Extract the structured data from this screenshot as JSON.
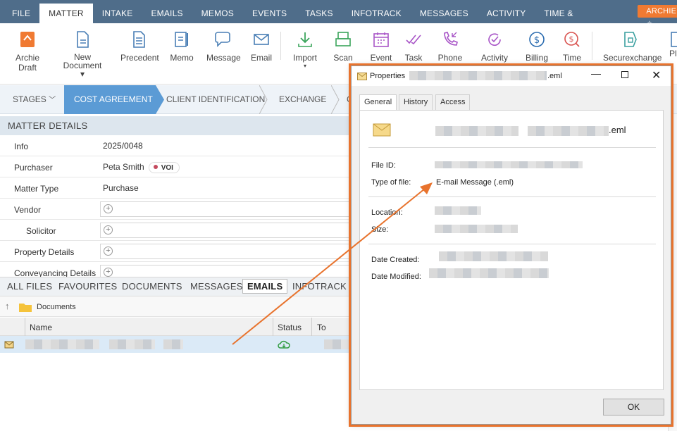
{
  "topmenu": {
    "items": [
      "FILE",
      "MATTER",
      "INTAKE",
      "EMAILS",
      "MEMOS",
      "EVENTS",
      "TASKS",
      "INFOTRACK",
      "MESSAGES",
      "ACTIVITY",
      "TIME & DISBURSEMENTS"
    ],
    "archie": "ARCHIE ✧"
  },
  "ribbon": {
    "archie_draft": "Archie Draft",
    "new_document": "New Document ▾",
    "precedent": "Precedent",
    "memo": "Memo",
    "message": "Message",
    "email": "Email",
    "import": "Import",
    "scan": "Scan",
    "event": "Event",
    "task": "Task",
    "phone": "Phone",
    "activity": "Activity",
    "billing": "Billing",
    "time": "Time",
    "securexchange": "Securexchange",
    "partial": "Pl"
  },
  "stages": {
    "stages_label": "STAGES",
    "items": [
      "COST AGREEMENT",
      "CLIENT IDENTIFICATION",
      "EXCHANGE",
      "C"
    ]
  },
  "matter_details": {
    "heading": "MATTER DETAILS",
    "info_label": "Info",
    "info_value": "2025/0048",
    "purchaser_label": "Purchaser",
    "purchaser_value": "Peta Smith",
    "purchaser_badge": "VOI",
    "matter_type_label": "Matter Type",
    "matter_type_value": "Purchase",
    "vendor_label": "Vendor",
    "solicitor_label": "Solicitor",
    "property_label": "Property Details",
    "conveyancing_label": "Conveyancing Details"
  },
  "file_tabs": [
    "ALL FILES",
    "FAVOURITES",
    "DOCUMENTS",
    "MESSAGES",
    "EMAILS",
    "INFOTRACK"
  ],
  "breadcrumb": "Documents",
  "columns": {
    "name": "Name",
    "status": "Status",
    "to": "To"
  },
  "dialog": {
    "title": "Properties",
    "title_suffix": ".eml",
    "tabs": [
      "General",
      "History",
      "Access"
    ],
    "file_name_suffix": ".eml",
    "file_id_label": "File ID:",
    "type_label": "Type of file:",
    "type_value": "E-mail Message (.eml)",
    "location_label": "Location:",
    "size_label": "Size:",
    "created_label": "Date Created:",
    "modified_label": "Date Modified:",
    "ok": "OK"
  },
  "colors": {
    "accent": "#e8732d",
    "stage_active": "#5b9bd5",
    "menu_bg": "#4f6d8a"
  }
}
